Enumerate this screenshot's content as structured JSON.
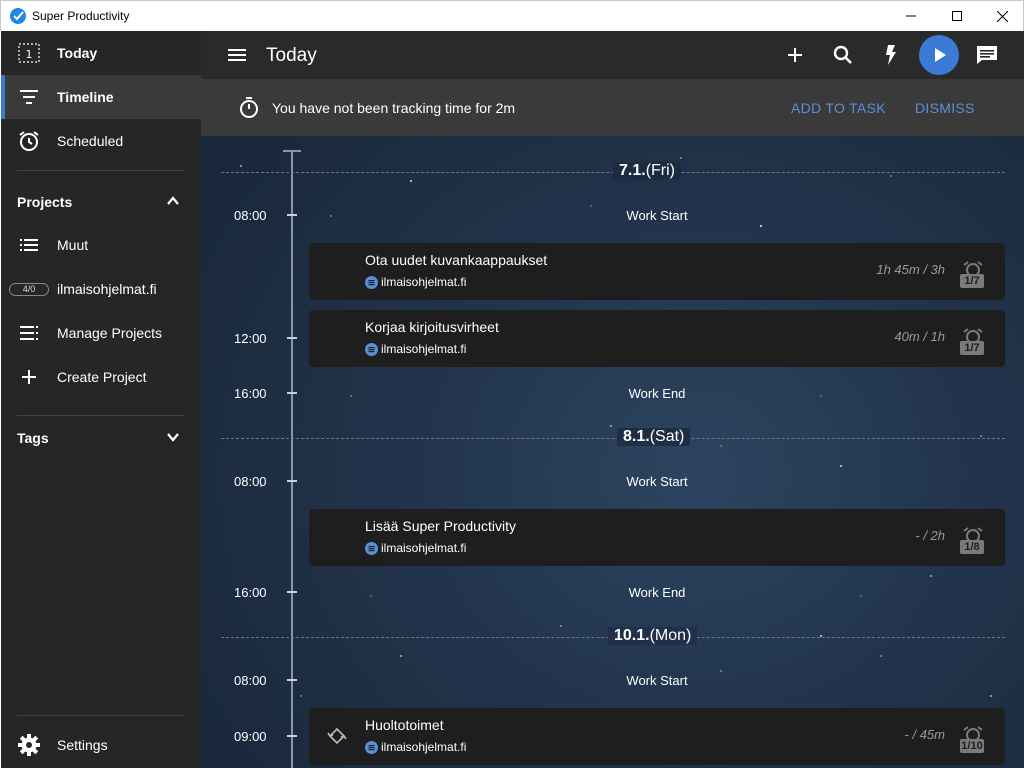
{
  "window": {
    "title": "Super Productivity"
  },
  "sidebar": {
    "today": {
      "label": "Today",
      "badge": "1"
    },
    "timeline": {
      "label": "Timeline"
    },
    "scheduled": {
      "label": "Scheduled"
    },
    "projects_title": "Projects",
    "projects": [
      {
        "label": "Muut"
      },
      {
        "label": "ilmaisohjelmat.fi",
        "count": "4/0"
      },
      {
        "label": "Manage Projects"
      },
      {
        "label": "Create Project"
      }
    ],
    "tags_title": "Tags",
    "settings": {
      "label": "Settings"
    }
  },
  "header": {
    "title": "Today"
  },
  "banner": {
    "message": "You have not been tracking time for 2m",
    "add_to_task": "ADD TO TASK",
    "dismiss": "DISMISS"
  },
  "timeline": {
    "days": [
      {
        "date": "7.1.",
        "weekday": "(Fri)"
      },
      {
        "date": "8.1.",
        "weekday": "(Sat)"
      },
      {
        "date": "10.1.",
        "weekday": "(Mon)"
      }
    ],
    "times": [
      "08:00",
      "12:00",
      "16:00",
      "08:00",
      "16:00",
      "08:00",
      "09:00"
    ],
    "events": [
      "Work Start",
      "Work End",
      "Work Start",
      "Work End",
      "Work Start"
    ],
    "tasks": [
      {
        "title": "Ota uudet kuvankaappaukset",
        "project": "ilmaisohjelmat.fi",
        "time": "1h 45m / 3h",
        "count": "1/7"
      },
      {
        "title": "Korjaa kirjoitusvirheet",
        "project": "ilmaisohjelmat.fi",
        "time": "40m / 1h",
        "count": "1/7"
      },
      {
        "title": "Lisää Super Productivity",
        "project": "ilmaisohjelmat.fi",
        "time": "- / 2h",
        "count": "1/8"
      },
      {
        "title": "Huoltotoimet",
        "project": "ilmaisohjelmat.fi",
        "time": "- / 45m",
        "count": "1/10"
      }
    ]
  },
  "colors": {
    "accent": "#3b7bd6",
    "sidebar_bg": "#262626",
    "header_bg": "#2a2a2a",
    "banner_bg": "#3a3a3a",
    "task_bg": "#1e1e1e"
  },
  "icons": [
    "app-logo-icon",
    "minimize-icon",
    "maximize-icon",
    "close-icon",
    "today-icon",
    "timeline-icon",
    "alarm-clock-icon",
    "chevron-up-icon",
    "list-icon",
    "manage-list-icon",
    "plus-icon",
    "chevron-down-icon",
    "gear-icon",
    "menu-icon",
    "search-icon",
    "flash-icon",
    "play-icon",
    "chat-icon",
    "timer-icon",
    "repeat-icon"
  ]
}
